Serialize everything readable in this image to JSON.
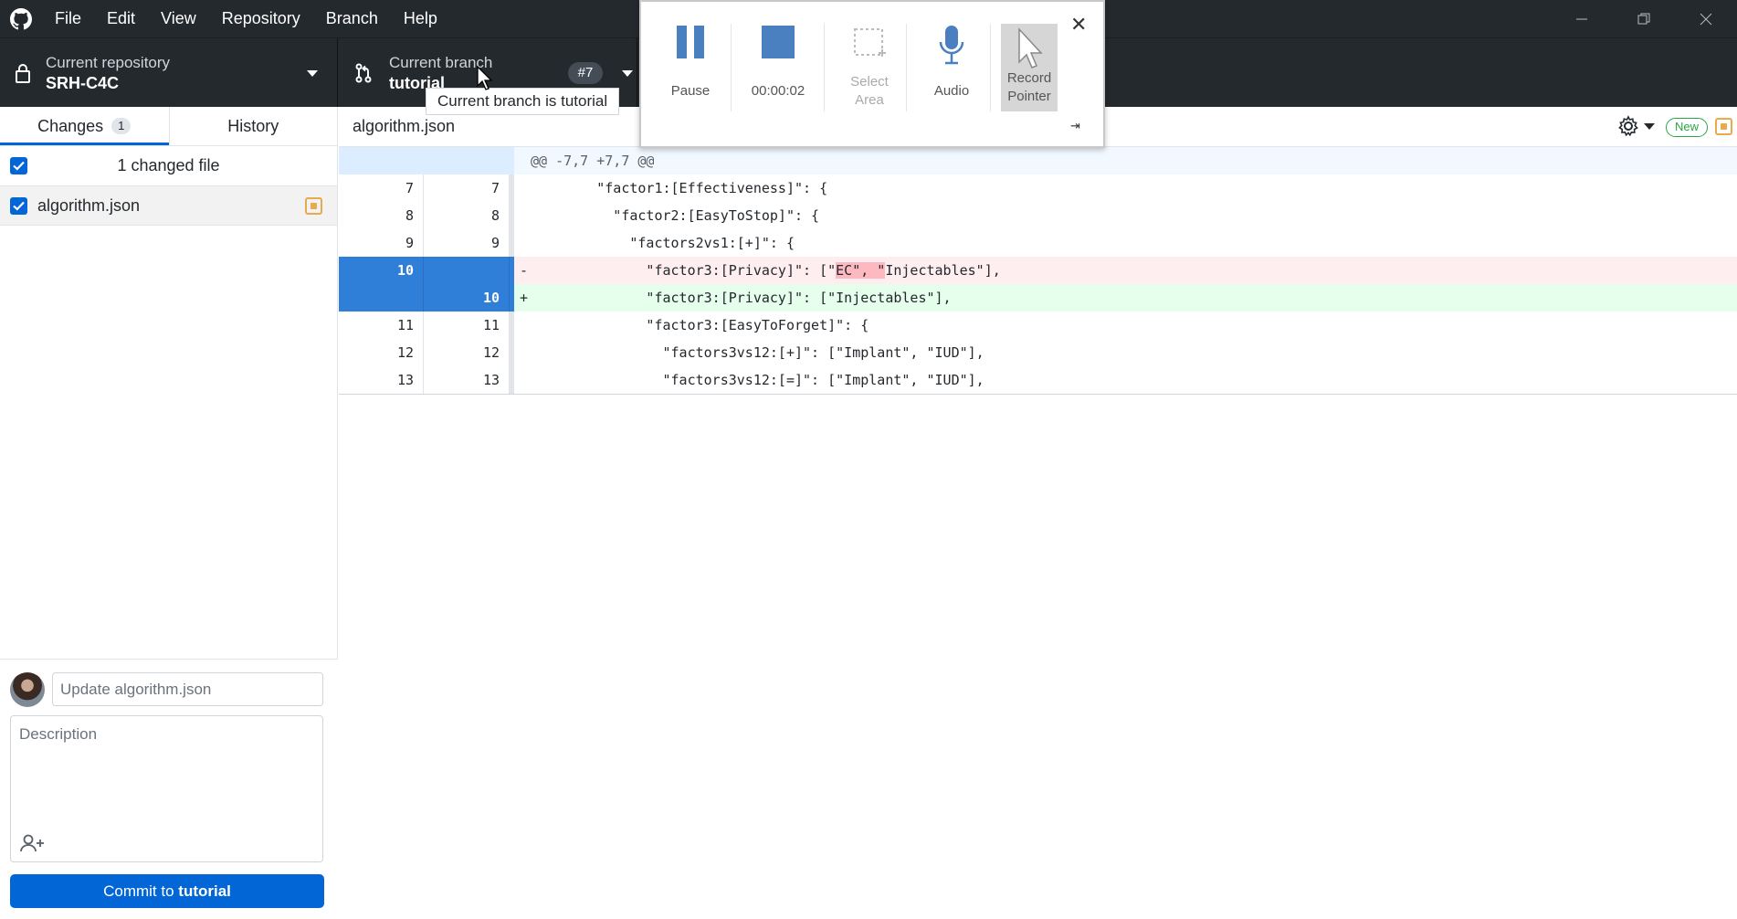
{
  "menu": [
    "File",
    "Edit",
    "View",
    "Repository",
    "Branch",
    "Help"
  ],
  "toolbar": {
    "repo_label": "Current repository",
    "repo_name": "SRH-C4C",
    "branch_label": "Current branch",
    "branch_name": "tutorial",
    "pr_badge": "#7"
  },
  "tooltip": "Current branch is tutorial",
  "recorder": {
    "pause": "Pause",
    "timer": "00:00:02",
    "select_area_1": "Select",
    "select_area_2": "Area",
    "audio": "Audio",
    "record_pointer_1": "Record",
    "record_pointer_2": "Pointer",
    "close": "✕",
    "pin": "⇥"
  },
  "sidebar": {
    "tabs": [
      {
        "label": "Changes",
        "count": "1"
      },
      {
        "label": "History"
      }
    ],
    "changed_files_label": "1 changed file",
    "files": [
      {
        "name": "algorithm.json"
      }
    ]
  },
  "commit": {
    "summary_placeholder": "Update algorithm.json",
    "description_placeholder": "Description",
    "button_prefix": "Commit to ",
    "button_branch": "tutorial"
  },
  "diff": {
    "file": "algorithm.json",
    "new_badge": "New",
    "hunk": "@@ -7,7 +7,7 @@",
    "lines": [
      {
        "old": "7",
        "new": "7",
        "type": "ctx",
        "sign": "",
        "code": "        \"factor1:[Effectiveness]\": {"
      },
      {
        "old": "8",
        "new": "8",
        "type": "ctx",
        "sign": "",
        "code": "          \"factor2:[EasyToStop]\": {"
      },
      {
        "old": "9",
        "new": "9",
        "type": "ctx",
        "sign": "",
        "code": "            \"factors2vs1:[+]\": {"
      },
      {
        "old": "10",
        "new": "",
        "type": "del",
        "sign": "-",
        "code_pre": "              \"factor3:[Privacy]\": [\"",
        "code_hl": "EC\", \"",
        "code_post": "Injectables\"],"
      },
      {
        "old": "",
        "new": "10",
        "type": "add",
        "sign": "+",
        "code": "              \"factor3:[Privacy]\": [\"Injectables\"],"
      },
      {
        "old": "11",
        "new": "11",
        "type": "ctx",
        "sign": "",
        "code": "              \"factor3:[EasyToForget]\": {"
      },
      {
        "old": "12",
        "new": "12",
        "type": "ctx",
        "sign": "",
        "code": "                \"factors3vs12:[+]\": [\"Implant\", \"IUD\"],"
      },
      {
        "old": "13",
        "new": "13",
        "type": "ctx",
        "sign": "",
        "code": "                \"factors3vs12:[=]\": [\"Implant\", \"IUD\"],"
      }
    ]
  },
  "colors": {
    "accent": "#0366d6",
    "titlebar": "#24292e",
    "added": "#e6ffed",
    "deleted": "#ffeef0",
    "modified": "#e9a94d"
  }
}
